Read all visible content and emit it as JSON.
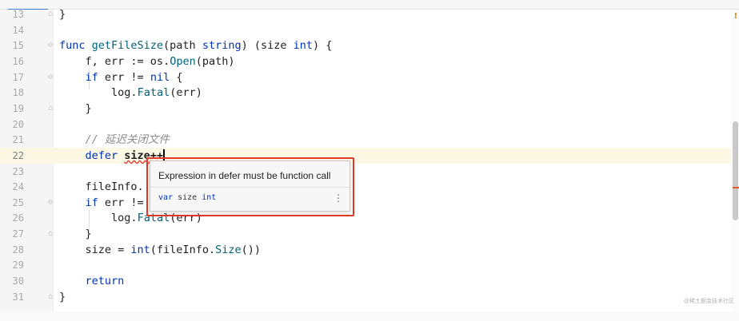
{
  "editor": {
    "lines": [
      {
        "num": "13",
        "code": "}"
      },
      {
        "num": "14",
        "code": ""
      },
      {
        "num": "15",
        "kw1": "func ",
        "fn": "getFileSize",
        "rest1": "(path ",
        "ty1": "string",
        "rest2": ") (size ",
        "ty2": "int",
        "rest3": ") {"
      },
      {
        "num": "16",
        "plain": "    f, err := ",
        "pkg": "os",
        "dot": ".",
        "method": "Open",
        "tail": "(path)"
      },
      {
        "num": "17",
        "kw1": "    if ",
        "plain": "err != ",
        "kw2": "nil",
        "tail": " {"
      },
      {
        "num": "18",
        "plain": "        ",
        "pkg": "log",
        "dot": ".",
        "method": "Fatal",
        "tail": "(err)"
      },
      {
        "num": "19",
        "code": "    }"
      },
      {
        "num": "20",
        "code": ""
      },
      {
        "num": "21",
        "comment": "    // 延迟关闭文件"
      },
      {
        "num": "22",
        "kw1": "    defer ",
        "err_word": "size++"
      },
      {
        "num": "23",
        "code": ""
      },
      {
        "num": "24",
        "code": "    fileInfo."
      },
      {
        "num": "25",
        "kw1": "    if ",
        "plain": "err !="
      },
      {
        "num": "26",
        "plain": "        ",
        "pkg": "log",
        "dot": ".",
        "method": "Fatal",
        "tail": "(err)"
      },
      {
        "num": "27",
        "code": "    }"
      },
      {
        "num": "28",
        "plain": "    size = ",
        "ty": "int",
        "mid": "(fileInfo.",
        "method": "Size",
        "tail": "())"
      },
      {
        "num": "29",
        "code": ""
      },
      {
        "num": "30",
        "kw1": "    return"
      },
      {
        "num": "31",
        "code": "}"
      }
    ]
  },
  "popup": {
    "message": "Expression in defer must be function call",
    "sig_kw": "var",
    "sig_name": " size ",
    "sig_type": "int",
    "more": "⋮"
  },
  "warning_badge": "!",
  "watermark": "@稀土掘金技术社区",
  "colors": {
    "keyword": "#0033b3",
    "function": "#00627a",
    "comment": "#8c8c8c",
    "error": "#e23a2a",
    "current_line": "#fcf8e3"
  }
}
